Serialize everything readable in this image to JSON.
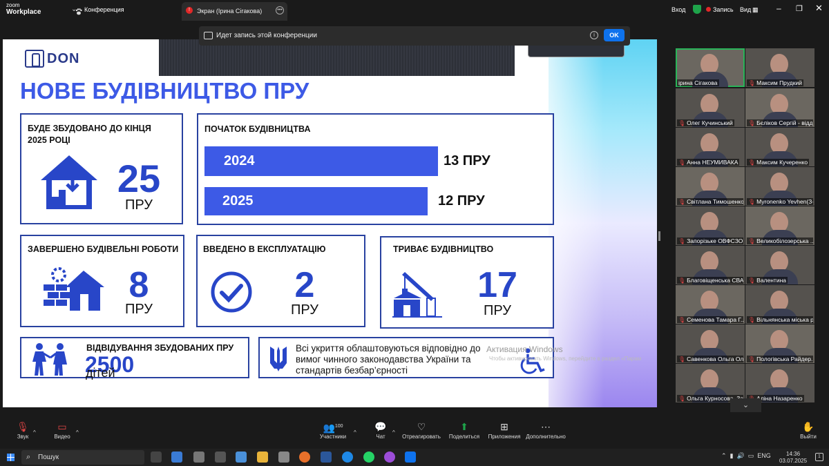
{
  "app": {
    "brand_small": "zoom",
    "brand_big": "Workplace",
    "conference_label": "Конференция"
  },
  "tab": {
    "title": "Экран (Ірина Сігакова)"
  },
  "topbar": {
    "login": "Вход",
    "record": "Запись",
    "view": "Вид"
  },
  "recording_banner": {
    "text": "Идет запись этой конференции",
    "ok": "OK"
  },
  "slide": {
    "logo_text": "DON",
    "title": "НОВЕ БУДІВНИЦТВО ПРУ",
    "built_by_2025": {
      "heading_line1": "БУДЕ ЗБУДОВАНО ДО КІНЦЯ",
      "heading_line2": "2025 РОЦІ",
      "value": "25",
      "unit": "ПРУ"
    },
    "start": {
      "heading": "ПОЧАТОК БУДІВНИЦТВА",
      "rows": [
        {
          "year": "2024",
          "value": "13 ПРУ"
        },
        {
          "year": "2025",
          "value": "12 ПРУ"
        }
      ]
    },
    "completed": {
      "heading": "ЗАВЕРШЕНО БУДІВЕЛЬНІ РОБОТИ",
      "value": "8",
      "unit": "ПРУ"
    },
    "commissioned": {
      "heading": "ВВЕДЕНО В ЕКСПЛУАТАЦІЮ",
      "value": "2",
      "unit": "ПРУ"
    },
    "ongoing": {
      "heading": "ТРИВАЄ БУДІВНИЦТВО",
      "value": "17",
      "unit": "ПРУ"
    },
    "visits": {
      "heading": "ВІДВІДУВАННЯ ЗБУДОВАНИХ ПРУ",
      "value": "2500",
      "unit": "дітей"
    },
    "accessibility": {
      "line1": "Всі укриття облаштовуються відповідно до",
      "line2": "вимог чинного законодавства України та",
      "line3": "стандартів безбар’єрності"
    }
  },
  "watermark": {
    "line1": "Активация Windows",
    "line2": "Чтобы активировать Windows, перейдите в раздел «Параметры»."
  },
  "participants": [
    "ірина Сігакова",
    "Максим Прудкий",
    "Олег Кучинський",
    "Бєліков Сергій - відді...",
    "Анна НЕУМИВАКА",
    "Максим Кучеренко",
    "Світлана Тимошенко",
    "Myronenko Yevhen(З-...",
    "Запорізьке ОВФСЗО",
    "Великобілозерська ...",
    "Благовіщенська СВА",
    "Валентина",
    "Семенова Тамара Г...",
    "Вільнянська міська р...",
    "Савенкова Ольга Ол...",
    "Пологівська Райдер...",
    "Ольга Курносова, За...",
    "Аліна Назаренко"
  ],
  "toolbar": {
    "audio": "Звук",
    "video": "Видео",
    "participants": "Участники",
    "participants_count": "100",
    "chat": "Чат",
    "react": "Отреагировать",
    "share": "Поделиться",
    "apps": "Приложения",
    "more": "Дополнительно",
    "leave": "Выйти"
  },
  "taskbar": {
    "search": "Пошук",
    "lang": "ENG",
    "time": "14:36",
    "date": "03.07.2025",
    "notifications": "1"
  }
}
